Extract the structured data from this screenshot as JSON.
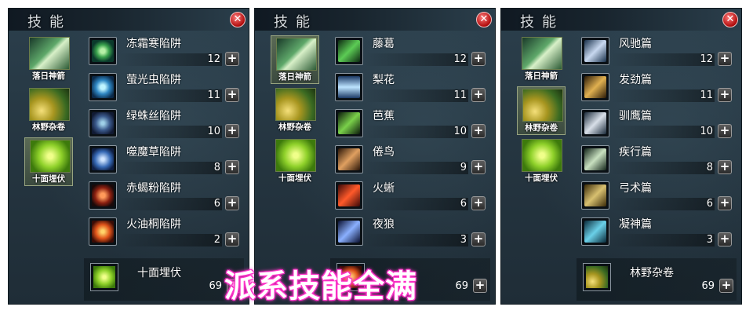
{
  "banner": "派系技能全满",
  "panels": [
    {
      "title": "技能",
      "close_symbol": "✕",
      "categories": [
        {
          "label": "落日神箭",
          "icon": "arrow-skill-icon"
        },
        {
          "label": "林野杂卷",
          "icon": "scroll-skill-icon"
        },
        {
          "label": "十面埋伏",
          "icon": "trap-skill-icon"
        }
      ],
      "skills": [
        {
          "name": "冻霜寒陷阱",
          "level": "12",
          "icon": "frost-trap-icon"
        },
        {
          "name": "萤光虫陷阱",
          "level": "11",
          "icon": "firefly-trap-icon"
        },
        {
          "name": "绿蛛丝陷阱",
          "level": "10",
          "icon": "spider-trap-icon"
        },
        {
          "name": "噬魔草陷阱",
          "level": "8",
          "icon": "demon-grass-trap-icon"
        },
        {
          "name": "赤蝎粉陷阱",
          "level": "6",
          "icon": "scorpion-trap-icon"
        },
        {
          "name": "火油桐陷阱",
          "level": "2",
          "icon": "fire-oil-trap-icon"
        }
      ],
      "summary": {
        "name": "十面埋伏",
        "level": "69",
        "icon": "trap-skill-icon"
      },
      "plus_symbol": "+"
    },
    {
      "title": "技能",
      "close_symbol": "✕",
      "categories": [
        {
          "label": "落日神箭",
          "icon": "arrow-skill-icon"
        },
        {
          "label": "林野杂卷",
          "icon": "scroll-skill-icon"
        },
        {
          "label": "十面埋伏",
          "icon": "trap-skill-icon"
        }
      ],
      "skills": [
        {
          "name": "藤葛",
          "level": "12",
          "icon": "vine-icon"
        },
        {
          "name": "梨花",
          "level": "11",
          "icon": "triple-arrow-icon"
        },
        {
          "name": "芭蕉",
          "level": "10",
          "icon": "plantain-icon"
        },
        {
          "name": "倦鸟",
          "level": "9",
          "icon": "bird-arrow-icon"
        },
        {
          "name": "火蜥",
          "level": "6",
          "icon": "fire-lizard-icon"
        },
        {
          "name": "夜狼",
          "level": "3",
          "icon": "night-wolf-icon"
        }
      ],
      "summary": {
        "name": "",
        "level": "69",
        "icon": "arrow-skill-icon"
      },
      "plus_symbol": "+"
    },
    {
      "title": "技能",
      "close_symbol": "✕",
      "categories": [
        {
          "label": "落日神箭",
          "icon": "arrow-skill-icon"
        },
        {
          "label": "林野杂卷",
          "icon": "scroll-skill-icon"
        },
        {
          "label": "十面埋伏",
          "icon": "trap-skill-icon"
        }
      ],
      "skills": [
        {
          "name": "风驰篇",
          "level": "12",
          "icon": "wind-arrow-icon"
        },
        {
          "name": "发劲篇",
          "level": "11",
          "icon": "force-icon"
        },
        {
          "name": "驯鹰篇",
          "level": "10",
          "icon": "hawk-icon"
        },
        {
          "name": "疾行篇",
          "level": "8",
          "icon": "run-icon"
        },
        {
          "name": "弓术篇",
          "level": "6",
          "icon": "bow-icon"
        },
        {
          "name": "凝神篇",
          "level": "3",
          "icon": "focus-icon"
        }
      ],
      "summary": {
        "name": "林野杂卷",
        "level": "69",
        "icon": "scroll-skill-icon"
      },
      "plus_symbol": "+"
    }
  ]
}
